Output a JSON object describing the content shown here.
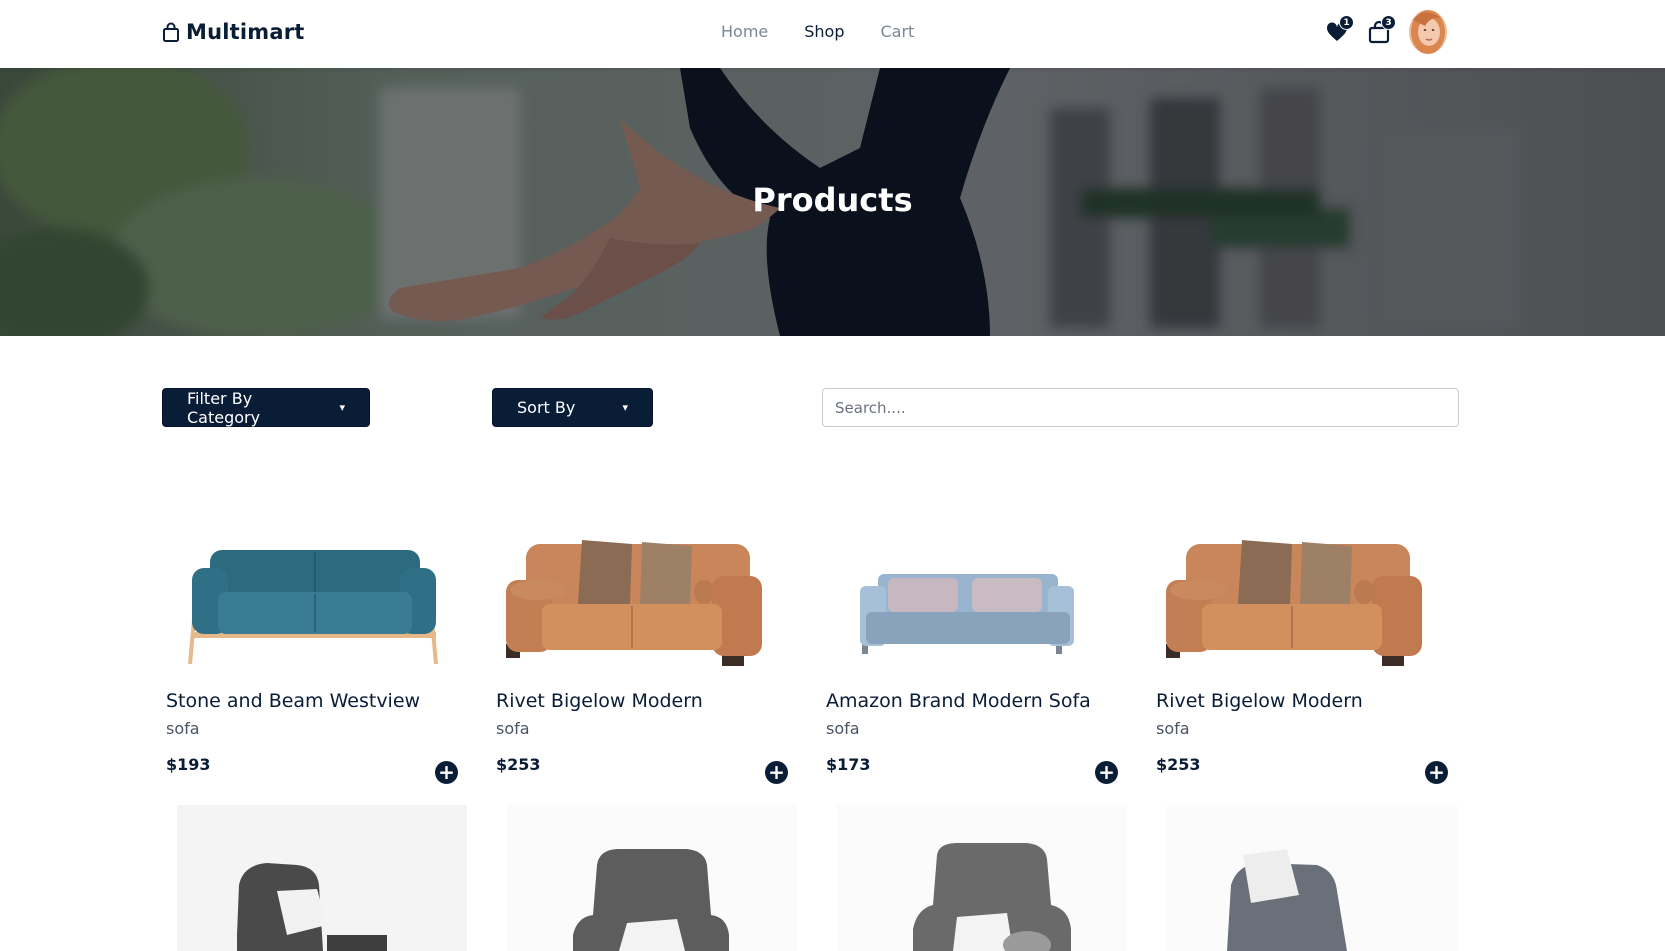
{
  "header": {
    "brand": "Multimart",
    "nav": [
      {
        "label": "Home",
        "active": false
      },
      {
        "label": "Shop",
        "active": true
      },
      {
        "label": "Cart",
        "active": false
      }
    ],
    "favorites_count": "1",
    "cart_count": "3"
  },
  "hero": {
    "title": "Products"
  },
  "controls": {
    "filter_label": "Filter By Category",
    "sort_label": "Sort By",
    "search_placeholder": "Search...."
  },
  "products": [
    {
      "name": "Stone and Beam Westview",
      "category": "sofa",
      "price": "$193",
      "color": "#2f6f86"
    },
    {
      "name": "Rivet Bigelow Modern",
      "category": "sofa",
      "price": "$253",
      "color": "#c98a5e"
    },
    {
      "name": "Amazon Brand Modern Sofa",
      "category": "sofa",
      "price": "$173",
      "color": "#8fb1cf"
    },
    {
      "name": "Rivet Bigelow Modern",
      "category": "sofa",
      "price": "$253",
      "color": "#c98a5e"
    }
  ],
  "colors": {
    "primary": "#0a1d37",
    "muted_text": "#7c8794"
  }
}
